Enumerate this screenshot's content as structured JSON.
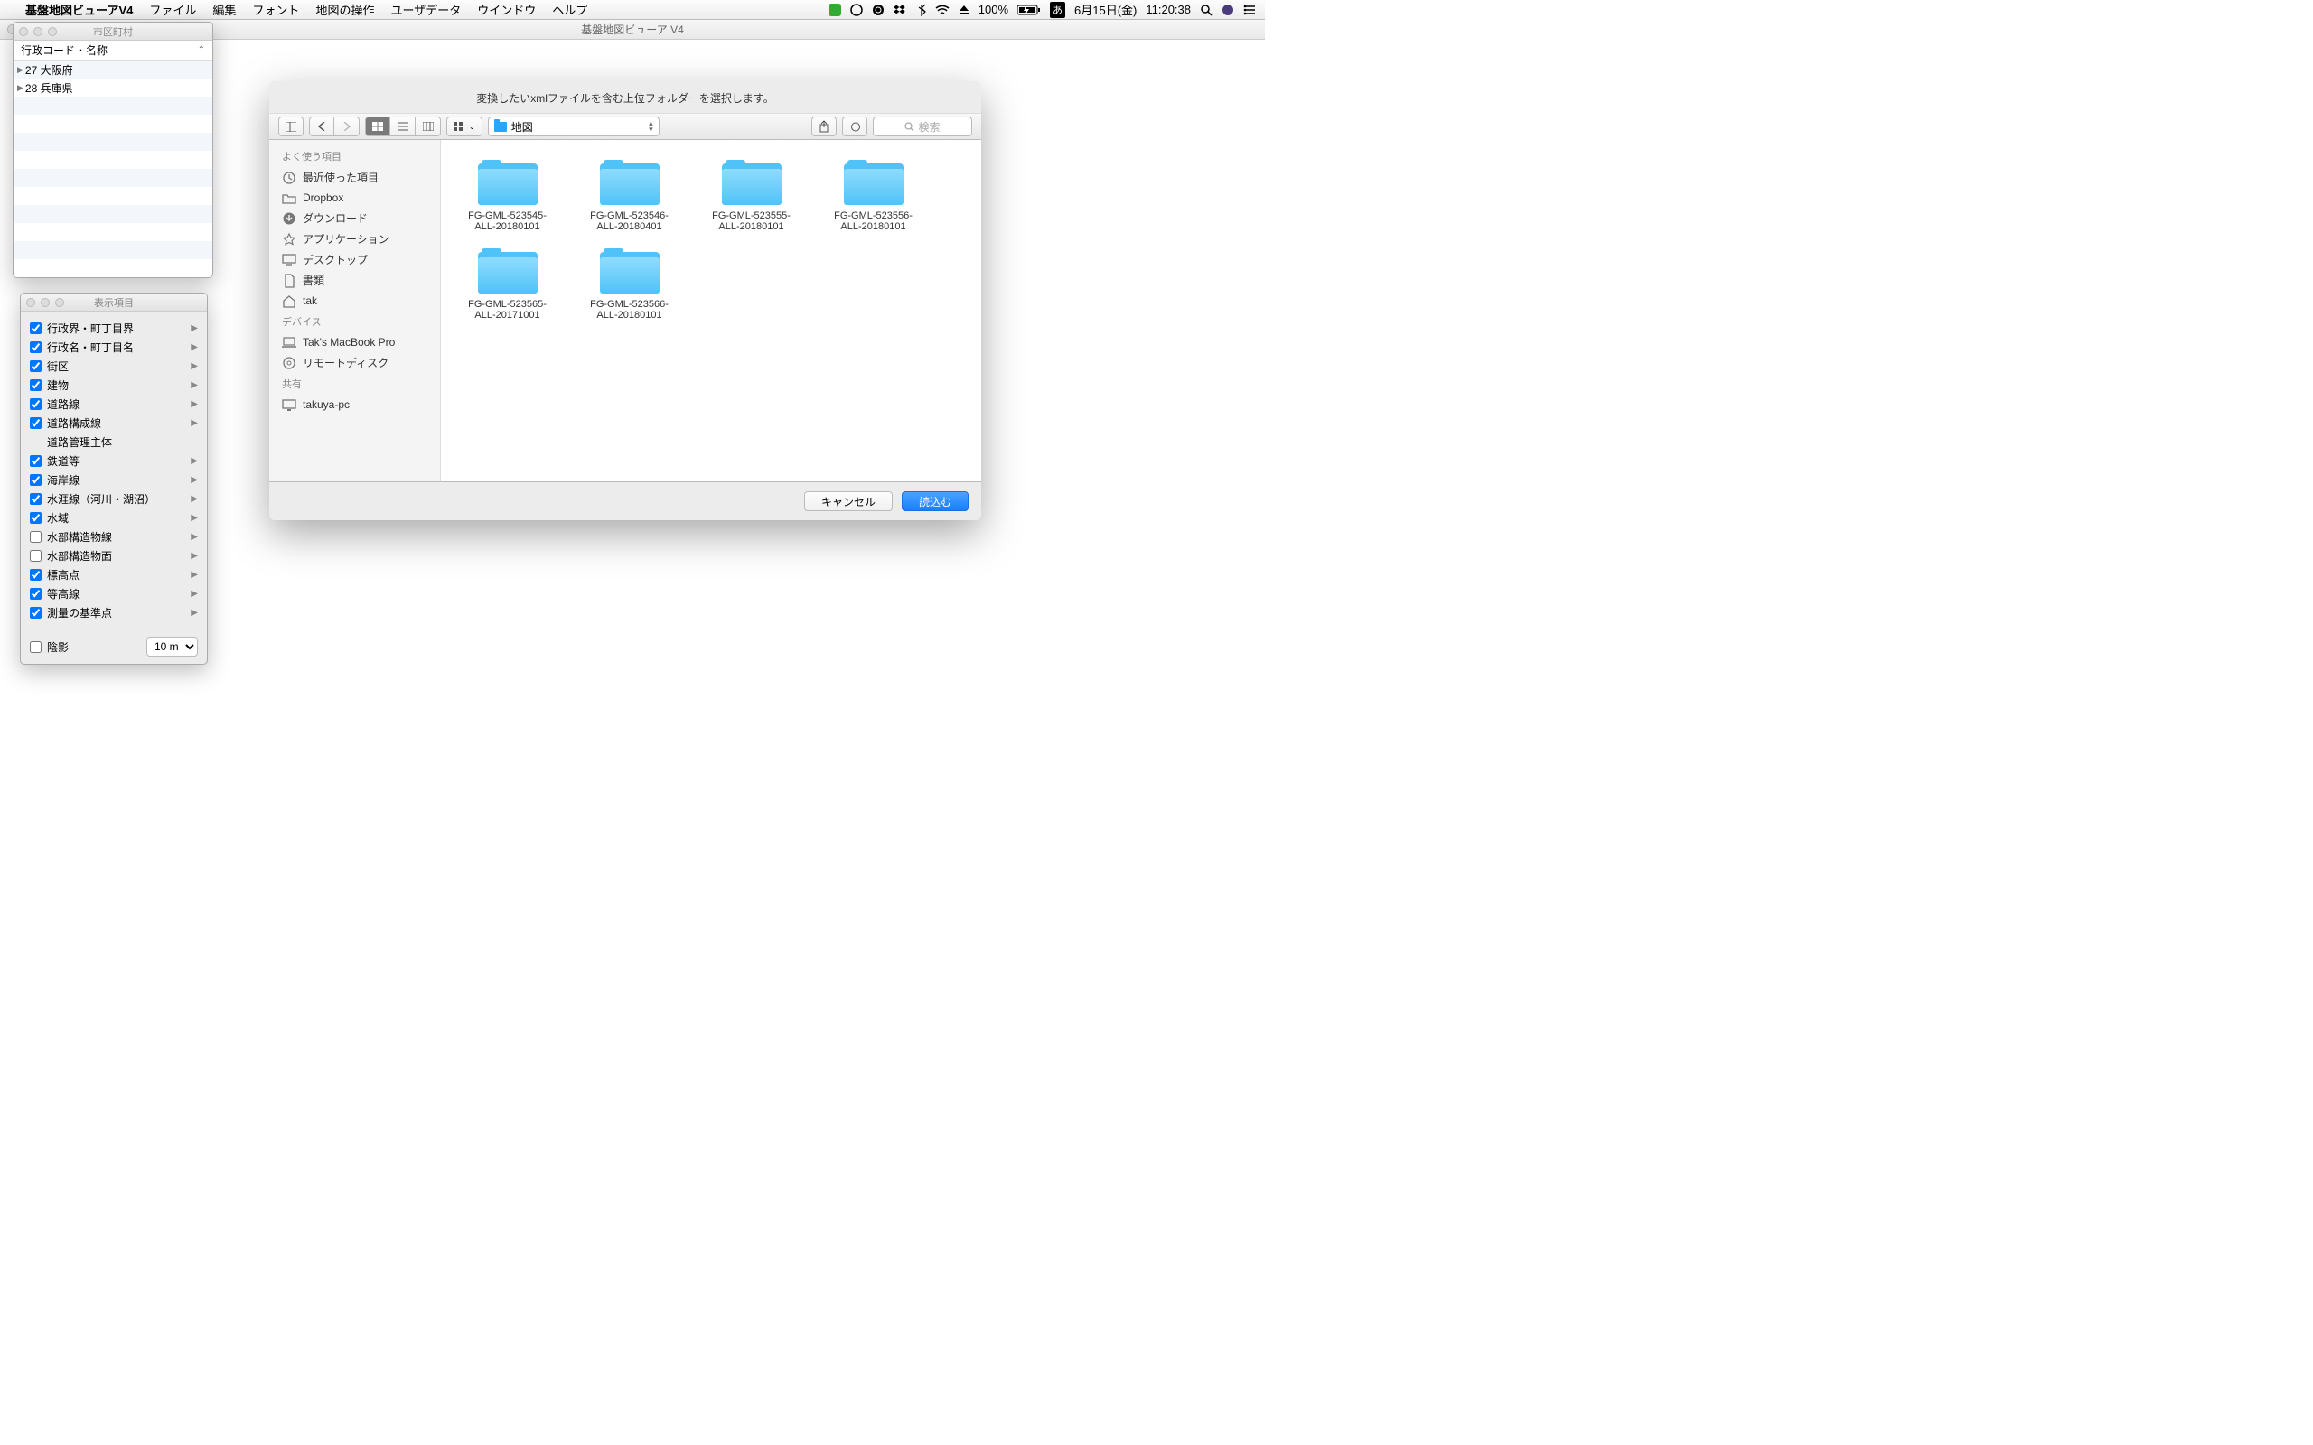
{
  "menubar": {
    "appname": "基盤地図ビューアV4",
    "items": [
      "ファイル",
      "編集",
      "フォント",
      "地図の操作",
      "ユーザデータ",
      "ウインドウ",
      "ヘルプ"
    ],
    "battery": "100%",
    "input_mode": "あ",
    "date": "6月15日(金)",
    "time": "11:20:38"
  },
  "main_window": {
    "title": "基盤地図ビューア V4"
  },
  "region_panel": {
    "title": "市区町村",
    "header": "行政コード・名称",
    "rows": [
      {
        "label": "27 大阪府"
      },
      {
        "label": "28 兵庫県"
      }
    ]
  },
  "items_panel": {
    "title": "表示項目",
    "items": [
      {
        "label": "行政界・町丁目界",
        "checked": true,
        "arrow": true
      },
      {
        "label": "行政名・町丁目名",
        "checked": true,
        "arrow": true
      },
      {
        "label": "街区",
        "checked": true,
        "arrow": true
      },
      {
        "label": "建物",
        "checked": true,
        "arrow": true
      },
      {
        "label": "道路線",
        "checked": true,
        "arrow": true
      },
      {
        "label": "道路構成線",
        "checked": true,
        "arrow": true
      },
      {
        "label": "道路管理主体",
        "checked": false,
        "arrow": false,
        "indent": true,
        "nobox": true
      },
      {
        "label": "鉄道等",
        "checked": true,
        "arrow": true
      },
      {
        "label": "海岸線",
        "checked": true,
        "arrow": true
      },
      {
        "label": "水涯線（河川・湖沼）",
        "checked": true,
        "arrow": true
      },
      {
        "label": "水域",
        "checked": true,
        "arrow": true
      },
      {
        "label": "水部構造物線",
        "checked": false,
        "arrow": true
      },
      {
        "label": "水部構造物面",
        "checked": false,
        "arrow": true
      },
      {
        "label": "標高点",
        "checked": true,
        "arrow": true
      },
      {
        "label": "等高線",
        "checked": true,
        "arrow": true
      },
      {
        "label": "測量の基準点",
        "checked": true,
        "arrow": true
      }
    ],
    "shadow_label": "陰影",
    "resolution": "10 m"
  },
  "dialog": {
    "prompt": "変換したいxmlファイルを含む上位フォルダーを選択します。",
    "path": "地図",
    "search_placeholder": "検索",
    "sidebar": {
      "favorites_header": "よく使う項目",
      "favorites": [
        {
          "label": "最近使った項目",
          "icon": "recents"
        },
        {
          "label": "Dropbox",
          "icon": "folder"
        },
        {
          "label": "ダウンロード",
          "icon": "downloads"
        },
        {
          "label": "アプリケーション",
          "icon": "apps"
        },
        {
          "label": "デスクトップ",
          "icon": "desktop"
        },
        {
          "label": "書類",
          "icon": "docs"
        },
        {
          "label": "tak",
          "icon": "home"
        }
      ],
      "devices_header": "デバイス",
      "devices": [
        {
          "label": "Tak's MacBook Pro",
          "icon": "laptop"
        },
        {
          "label": "リモートディスク",
          "icon": "disc"
        }
      ],
      "shared_header": "共有",
      "shared": [
        {
          "label": "takuya-pc",
          "icon": "screen"
        }
      ]
    },
    "files": [
      {
        "l1": "FG-GML-523545-",
        "l2": "ALL-20180101"
      },
      {
        "l1": "FG-GML-523546-",
        "l2": "ALL-20180401"
      },
      {
        "l1": "FG-GML-523555-",
        "l2": "ALL-20180101"
      },
      {
        "l1": "FG-GML-523556-",
        "l2": "ALL-20180101"
      },
      {
        "l1": "FG-GML-523565-",
        "l2": "ALL-20171001"
      },
      {
        "l1": "FG-GML-523566-",
        "l2": "ALL-20180101"
      }
    ],
    "cancel": "キャンセル",
    "confirm": "読込む"
  }
}
